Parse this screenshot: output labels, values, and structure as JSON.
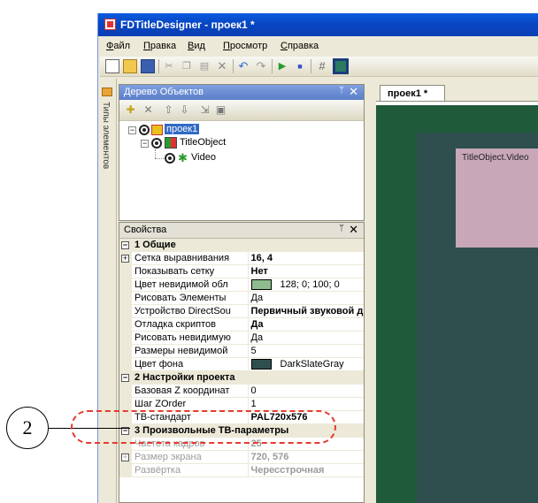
{
  "window": {
    "title": "FDTitleDesigner - проек1 *"
  },
  "menu": [
    "Файл",
    "Правка",
    "Вид",
    "Просмотр",
    "Справка"
  ],
  "sidebar_tab": "Типы элементов",
  "tree_panel": {
    "title": "Дерево Объектов",
    "pin": "ᛘ",
    "close": "✕",
    "nodes": [
      "проек1",
      "TitleObject",
      "Video"
    ]
  },
  "props_panel": {
    "title": "Свойства",
    "pin": "ᛘ",
    "close": "✕",
    "rows": [
      {
        "type": "cat",
        "name": "1 Общие"
      },
      {
        "name": "Сетка выравнивания",
        "value": "16, 4",
        "bold": true,
        "expand": true
      },
      {
        "name": "Показывать сетку",
        "value": "Нет",
        "bold": true
      },
      {
        "name": "Цвет невидимой обл",
        "value": "128; 0; 100; 0",
        "swatch": "#8FBC8F"
      },
      {
        "name": "Рисовать Элементы",
        "value": "Да"
      },
      {
        "name": "Устройство DirectSou",
        "value": "Первичный звуковой др",
        "bold": true
      },
      {
        "name": "Отладка скриптов",
        "value": "Да",
        "bold": true
      },
      {
        "name": "Рисовать невидимую",
        "value": "Да"
      },
      {
        "name": "Размеры невидимой",
        "value": "5"
      },
      {
        "name": "Цвет фона",
        "value": "DarkSlateGray",
        "swatch": "#2F4F4F"
      },
      {
        "type": "cat",
        "name": "2 Настройки проекта"
      },
      {
        "name": "Базовая Z координат",
        "value": "0"
      },
      {
        "name": "Шаг ZOrder",
        "value": "1"
      },
      {
        "name": "ТВ-стандарт",
        "value": "PAL720x576",
        "bold": true
      },
      {
        "type": "cat",
        "name": "3 Произвольные ТВ-параметры"
      },
      {
        "name": "Частота кадров",
        "value": "25",
        "bold": true,
        "disabled": true
      },
      {
        "name": "Размер экрана",
        "value": "720, 576",
        "bold": true,
        "disabled": true,
        "expand": true
      },
      {
        "name": "Развёртка",
        "value": "Чересстрочная",
        "bold": true,
        "disabled": true
      }
    ]
  },
  "document": {
    "tab": "проек1 *",
    "object_label": "TitleObject.Video"
  },
  "callout": {
    "number": "2"
  },
  "colors": {
    "canvas": "#1F5A3A",
    "frame": "#2F4F4F",
    "video": "#C8A8B8",
    "highlight": "#E53A2E"
  }
}
